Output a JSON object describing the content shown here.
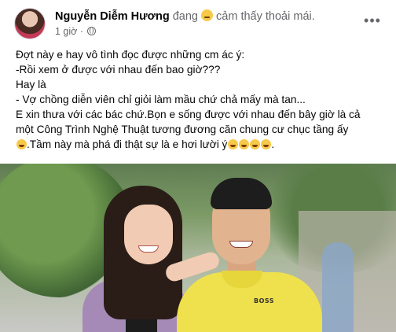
{
  "post": {
    "author_name": "Nguyễn Diễm Hương",
    "status_prefix": "đang",
    "status_suffix": "cảm thấy thoải mái.",
    "time": "1 giờ ·",
    "more_icon": "more-horizontal-icon",
    "privacy_icon": "globe-icon"
  },
  "body": {
    "lines": [
      "Đợt này e hay vô tình đọc được những cm ác ý:",
      "-Rồi xem ở được với nhau đến bao giờ???",
      "Hay là",
      "- Vợ chồng diễn viên chỉ giỏi làm mầu chứ chả mấy mà tan...",
      "E xin thưa với các bác chứ.Bọn e sống được với nhau đến bây giờ là cả",
      "một Công Trình Nghệ Thuật tương đương căn chung cư chục tầng ấy",
      ".Tầm này mà phá đi thật sự là e hơi lười ý"
    ]
  },
  "photo": {
    "shirt_text": "BOSS"
  },
  "colors": {
    "text": "#050505",
    "secondary_text": "#65676b",
    "shirt": "#efe14d",
    "jacket": "#a58ab8"
  }
}
